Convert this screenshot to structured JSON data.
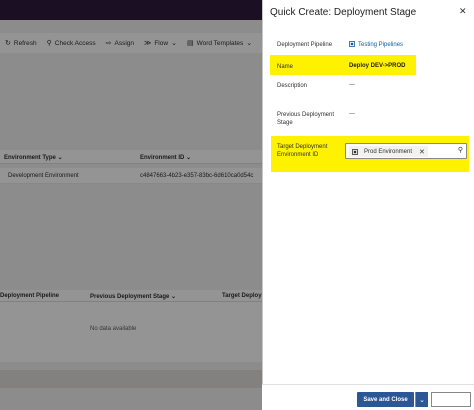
{
  "background": {
    "commands": [
      {
        "icon": "refresh-icon",
        "glyph": "↻",
        "label": "Refresh"
      },
      {
        "icon": "check-access-icon",
        "glyph": "⚲",
        "label": "Check Access"
      },
      {
        "icon": "assign-icon",
        "glyph": "⇨",
        "label": "Assign"
      },
      {
        "icon": "flow-icon",
        "glyph": "≫",
        "label": "Flow"
      },
      {
        "icon": "word-templates-icon",
        "glyph": "▤",
        "label": "Word Templates"
      }
    ],
    "grid": {
      "headers": [
        "Environment Type",
        "Environment ID"
      ],
      "row": [
        "Development Environment",
        "c4847663-4b23-e357-83bc-6d610ca0d54c"
      ]
    },
    "subgrid": {
      "headers": [
        "Deployment Pipeline",
        "Previous Deployment Stage",
        "Target Deployment"
      ],
      "empty_text": "No data available"
    }
  },
  "panel": {
    "title": "Quick Create: Deployment Stage",
    "fields": {
      "pipeline_label": "Deployment Pipeline",
      "pipeline_value": "Testing Pipelines",
      "name_label": "Name",
      "name_value": "Deploy DEV->PROD",
      "description_label": "Description",
      "description_value": "---",
      "previous_stage_label_1": "Previous Deployment",
      "previous_stage_label_2": "Stage",
      "previous_stage_value": "---",
      "target_env_label_1": "Target Deployment",
      "target_env_label_2": "Environment ID",
      "target_env_value": "Prod Environment"
    },
    "footer": {
      "save_label": "Save and Close"
    }
  },
  "colors": {
    "highlight": "#fff200",
    "primary_button": "#2b5797",
    "link": "#115ea3"
  }
}
